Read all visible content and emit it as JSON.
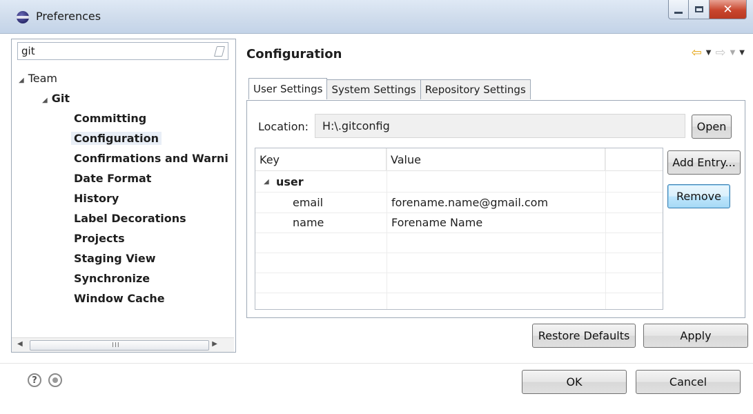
{
  "window": {
    "title": "Preferences"
  },
  "filter": {
    "value": "git"
  },
  "tree": {
    "team": "Team",
    "git": "Git",
    "items": [
      "Committing",
      "Configuration",
      "Confirmations and Warni",
      "Date Format",
      "History",
      "Label Decorations",
      "Projects",
      "Staging View",
      "Synchronize",
      "Window Cache"
    ],
    "selected": "Configuration"
  },
  "page": {
    "title": "Configuration"
  },
  "tabs": [
    "User Settings",
    "System Settings",
    "Repository Settings"
  ],
  "location": {
    "label": "Location:",
    "value": "H:\\.gitconfig"
  },
  "buttons": {
    "open": "Open",
    "add_entry": "Add Entry...",
    "remove": "Remove",
    "restore_defaults": "Restore Defaults",
    "apply": "Apply",
    "ok": "OK",
    "cancel": "Cancel"
  },
  "table": {
    "columns": [
      "Key",
      "Value"
    ],
    "group": "user",
    "rows": [
      {
        "key": "email",
        "value": "forename.name@gmail.com"
      },
      {
        "key": "name",
        "value": "Forename Name"
      }
    ]
  },
  "icons": {
    "nav_back": "back-arrow-icon",
    "nav_forward": "forward-arrow-icon",
    "help": "help-icon",
    "preferences_link": "record-icon"
  }
}
